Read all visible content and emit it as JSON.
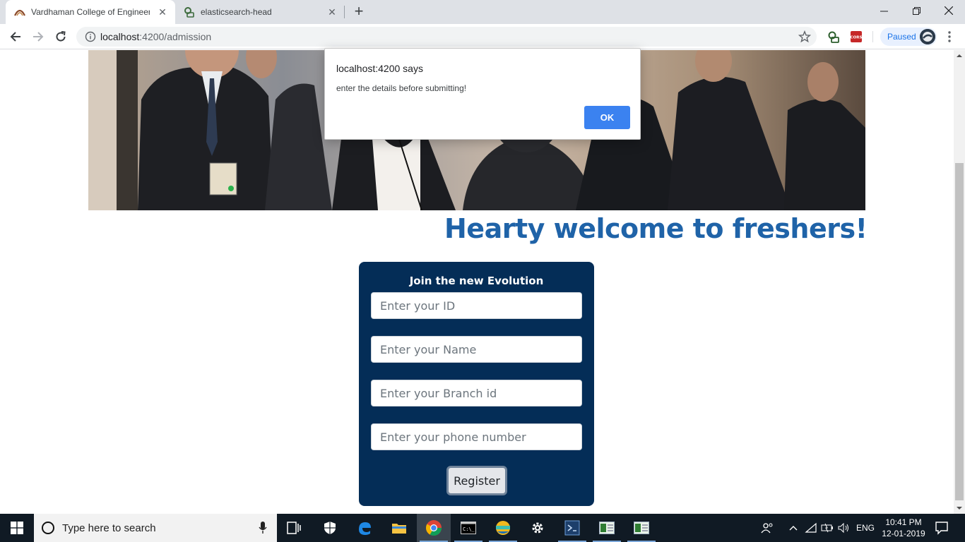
{
  "browser": {
    "tabs": [
      {
        "title": "Vardhaman College of Engineerin",
        "active": true
      },
      {
        "title": "elasticsearch-head",
        "active": false
      }
    ],
    "url_host": "localhost",
    "url_rest": ":4200/admission",
    "profile_status": "Paused",
    "ext_cors_label": "CORS"
  },
  "page": {
    "welcome_heading": "Hearty welcome to freshers!",
    "form": {
      "title": "Join the new Evolution",
      "id_placeholder": "Enter your ID",
      "name_placeholder": "Enter your Name",
      "branch_placeholder": "Enter your Branch id",
      "phone_placeholder": "Enter your phone number",
      "register_label": "Register"
    }
  },
  "alert": {
    "title": "localhost:4200 says",
    "message": "enter the details before submitting!",
    "ok_label": "OK"
  },
  "taskbar": {
    "search_placeholder": "Type here to search",
    "language": "ENG",
    "time": "10:41 PM",
    "date": "12-01-2019"
  },
  "colors": {
    "heading": "#1f63a8",
    "form_bg": "#042d57",
    "alert_ok": "#3b82f0",
    "taskbar": "#101a24"
  }
}
